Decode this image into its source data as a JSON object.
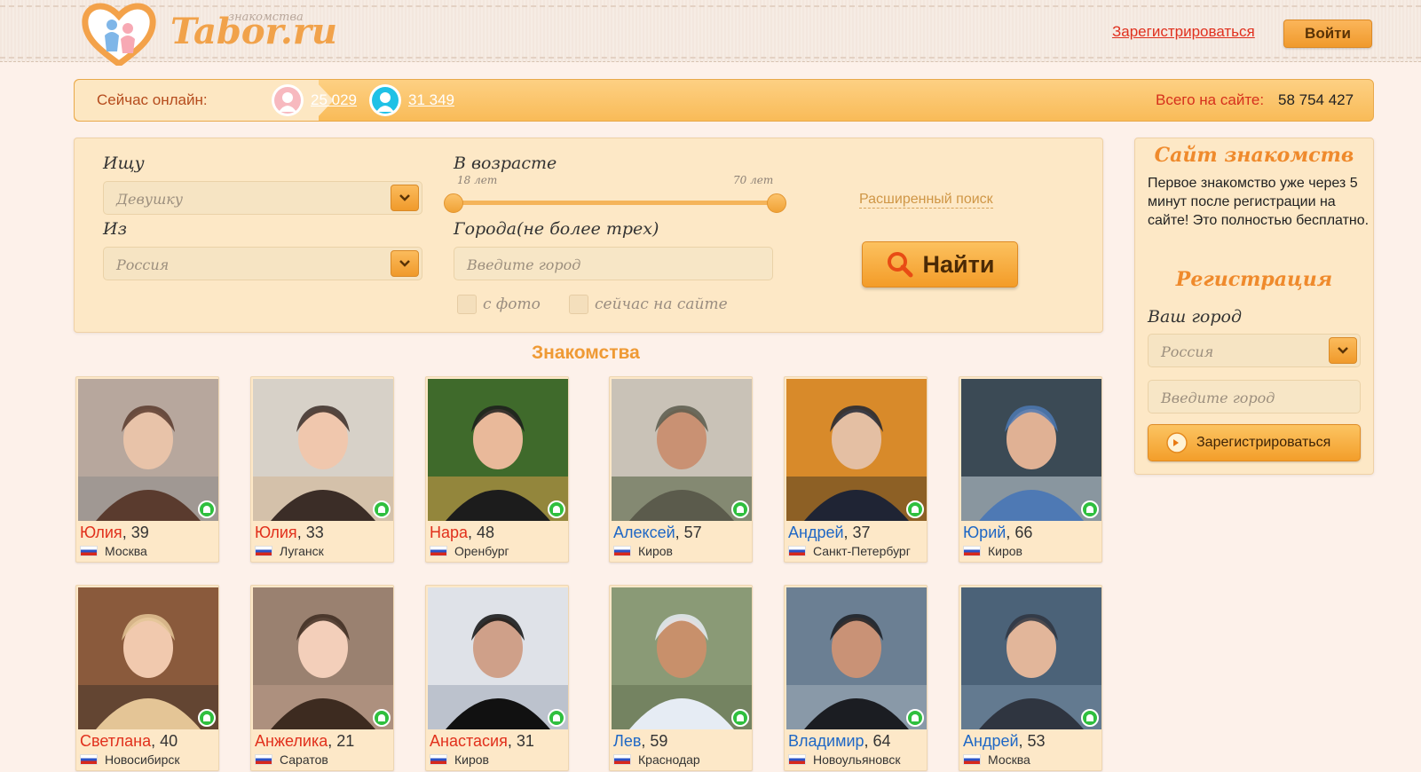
{
  "header": {
    "logo_text": "Tabor.ru",
    "logo_sub": "знакомства",
    "register_link": "Зарегистрироваться",
    "login_button": "Войти"
  },
  "online": {
    "label": "Сейчас онлайн:",
    "women_count": "25 029",
    "men_count": "31 349",
    "total_label": "Всего на сайте:",
    "total_value": "58 754 427"
  },
  "search": {
    "seeking_label": "Ищу",
    "seeking_value": "Девушку",
    "from_label": "Из",
    "from_value": "Россия",
    "age_label": "В возрасте",
    "age_min": "18 лет",
    "age_max": "70 лет",
    "cities_label": "Города(не более трех)",
    "city_placeholder": "Введите город",
    "with_photo_label": "с фото",
    "online_now_label": "сейчас на сайте",
    "advanced_link": "Расширенный поиск",
    "find_button": "Найти"
  },
  "section_title": "Знакомства",
  "profiles": [
    {
      "name": "Юлия",
      "age": ", 39",
      "city": "Москва",
      "gender": "female"
    },
    {
      "name": "Юлия",
      "age": ", 33",
      "city": "Луганск",
      "gender": "female"
    },
    {
      "name": "Нара",
      "age": ", 48",
      "city": "Оренбург",
      "gender": "female"
    },
    {
      "name": "Алексей",
      "age": ", 57",
      "city": "Киров",
      "gender": "male"
    },
    {
      "name": "Андрей",
      "age": ", 37",
      "city": "Санкт-Петербург",
      "gender": "male"
    },
    {
      "name": "Юрий",
      "age": ", 66",
      "city": "Киров",
      "gender": "male"
    },
    {
      "name": "Светлана",
      "age": ", 40",
      "city": "Новосибирск",
      "gender": "female"
    },
    {
      "name": "Анжелика",
      "age": ", 21",
      "city": "Саратов",
      "gender": "female"
    },
    {
      "name": "Анастасия",
      "age": ", 31",
      "city": "Киров",
      "gender": "female"
    },
    {
      "name": "Лев",
      "age": ", 59",
      "city": "Краснодар",
      "gender": "male"
    },
    {
      "name": "Владимир",
      "age": ", 64",
      "city": "Новоульяновск",
      "gender": "male"
    },
    {
      "name": "Андрей",
      "age": ", 53",
      "city": "Москва",
      "gender": "male"
    }
  ],
  "side": {
    "title": "Сайт знакомств",
    "text": "Первое знакомство уже через 5 минут после регистрации на сайте! Это полностью бесплатно.",
    "reg_title": "Регистрация",
    "city_label": "Ваш город",
    "country_value": "Россия",
    "city_placeholder": "Введите город",
    "register_button": "Зарегистрироваться"
  },
  "colors": {
    "accent_orange": "#f39c28",
    "female_name": "#e1301c",
    "male_name": "#1e67c5",
    "online_green": "#2fbf3e"
  }
}
